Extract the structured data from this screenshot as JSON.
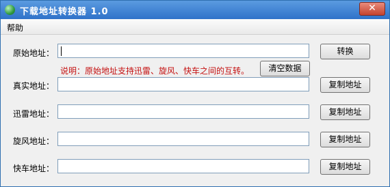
{
  "window": {
    "title": "下载地址转换器  1.0",
    "close_label": "✕"
  },
  "menu": {
    "help": "帮助"
  },
  "rows": [
    {
      "label": "原始地址：",
      "value": "",
      "button": "转换"
    },
    {
      "label": "真实地址：",
      "value": "",
      "button": "复制地址"
    },
    {
      "label": "迅雷地址：",
      "value": "",
      "button": "复制地址"
    },
    {
      "label": "旋风地址：",
      "value": "",
      "button": "复制地址"
    },
    {
      "label": "快车地址：",
      "value": "",
      "button": "复制地址"
    }
  ],
  "note": "说明：原始地址支持迅雷、旋风、快车之间的互转。",
  "clear_button": "清空数据",
  "colors": {
    "titlebar": "#2f72c9",
    "note_text": "#c41010"
  }
}
